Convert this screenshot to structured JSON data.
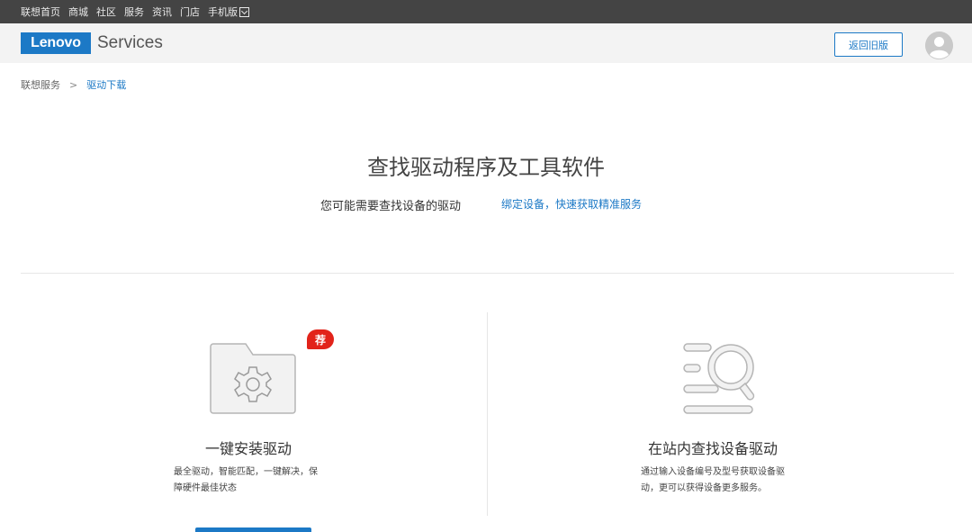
{
  "topbar": {
    "links": [
      "联想首页",
      "商城",
      "社区",
      "服务",
      "资讯",
      "门店"
    ],
    "mobile_label": "手机版"
  },
  "header": {
    "logo_text": "Lenovo",
    "services_text": "Services",
    "old_version_label": "返回旧版",
    "brand_color": "#1c79c6"
  },
  "breadcrumb": {
    "home": "联想服务",
    "separator": ">",
    "current": "驱动下载"
  },
  "hero": {
    "title": "查找驱动程序及工具软件",
    "subtitle": "您可能需要查找设备的驱动",
    "bind_link": "绑定设备，快速获取精准服务"
  },
  "cards": {
    "install": {
      "badge": "荐",
      "title": "一键安装驱动",
      "desc_line1": "最全驱动，智能匹配，一键解决，保",
      "desc_line2": "障硬件最佳状态",
      "icon": "folder-gear-icon"
    },
    "search": {
      "title": "在站内查找设备驱动",
      "desc_line1": "通过输入设备编号及型号获取设备驱",
      "desc_line2": "动，更可以获得设备更多服务。",
      "icon": "search-list-icon"
    }
  }
}
